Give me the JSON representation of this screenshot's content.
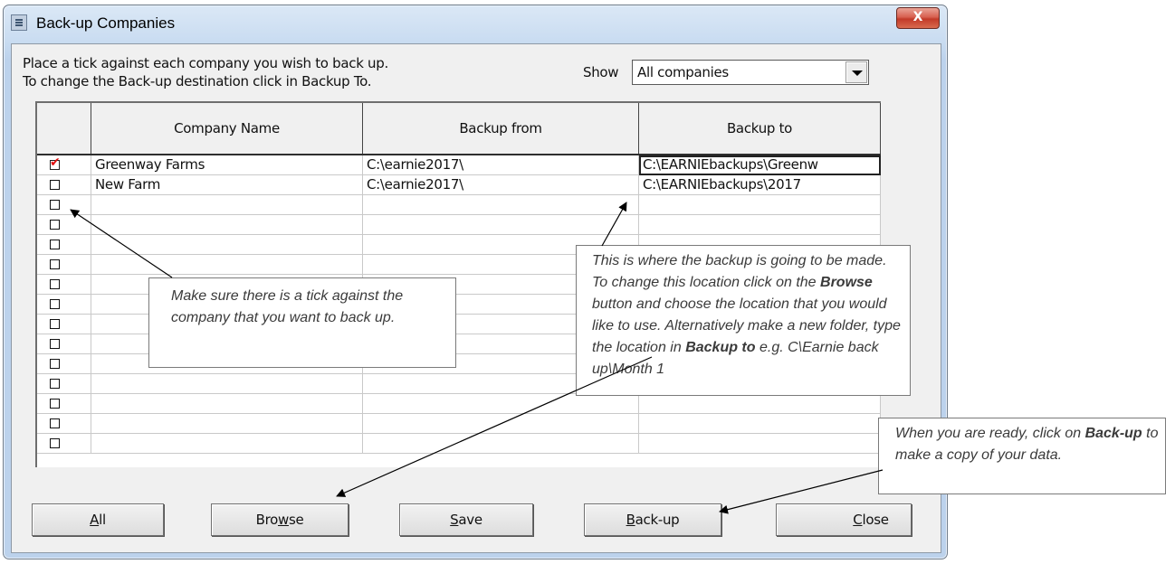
{
  "window": {
    "title": "Back-up Companies",
    "close_glyph": "X"
  },
  "instructions": {
    "line1": "Place a tick against each company you wish to back up.",
    "line2": "To change the Back-up destination click in Backup To."
  },
  "show": {
    "label": "Show",
    "value": "All companies"
  },
  "grid": {
    "headers": [
      "",
      "Company Name",
      "Backup from",
      "Backup to"
    ],
    "rows": [
      {
        "checked": true,
        "company": "Greenway Farms",
        "from": "C:\\earnie2017\\",
        "to": "C:\\EARNIEbackups\\Greenw"
      },
      {
        "checked": false,
        "company": "New Farm",
        "from": "C:\\earnie2017\\",
        "to": "C:\\EARNIEbackups\\2017"
      },
      {
        "checked": false,
        "company": "",
        "from": "",
        "to": ""
      },
      {
        "checked": false,
        "company": "",
        "from": "",
        "to": ""
      },
      {
        "checked": false,
        "company": "",
        "from": "",
        "to": ""
      },
      {
        "checked": false,
        "company": "",
        "from": "",
        "to": ""
      },
      {
        "checked": false,
        "company": "",
        "from": "",
        "to": ""
      },
      {
        "checked": false,
        "company": "",
        "from": "",
        "to": ""
      },
      {
        "checked": false,
        "company": "",
        "from": "",
        "to": ""
      },
      {
        "checked": false,
        "company": "",
        "from": "",
        "to": ""
      },
      {
        "checked": false,
        "company": "",
        "from": "",
        "to": ""
      },
      {
        "checked": false,
        "company": "",
        "from": "",
        "to": ""
      },
      {
        "checked": false,
        "company": "",
        "from": "",
        "to": ""
      },
      {
        "checked": false,
        "company": "",
        "from": "",
        "to": ""
      },
      {
        "checked": false,
        "company": "",
        "from": "",
        "to": ""
      }
    ]
  },
  "buttons": {
    "all": {
      "mnemonic": "A",
      "rest": "ll"
    },
    "browse": {
      "pre": "Bro",
      "mnemonic": "w",
      "rest": "se"
    },
    "save": {
      "mnemonic": "S",
      "rest": "ave"
    },
    "backup": {
      "mnemonic": "B",
      "rest": "ack-up"
    },
    "close": {
      "mnemonic": "C",
      "rest": "lose"
    }
  },
  "callouts": {
    "tick": "Make sure there is a tick against the company that you want to back up.",
    "location": {
      "text1": "This is where the backup is going to be made.  To change this location click on the ",
      "bold1": "Browse",
      "text2": " button and choose the location that you would like to use. Alternatively make a new folder, type the location in ",
      "bold2": "Backup to",
      "text3": " e.g. C\\Earnie back up\\Month 1"
    },
    "ready": {
      "text1": "When you are ready, click on ",
      "bold1": "Back-up",
      "text2": " to make a copy of your data."
    }
  },
  "colors": {
    "tick": "#e01010",
    "titlebar": "#c9dcf1",
    "close_button": "#c23a28"
  }
}
